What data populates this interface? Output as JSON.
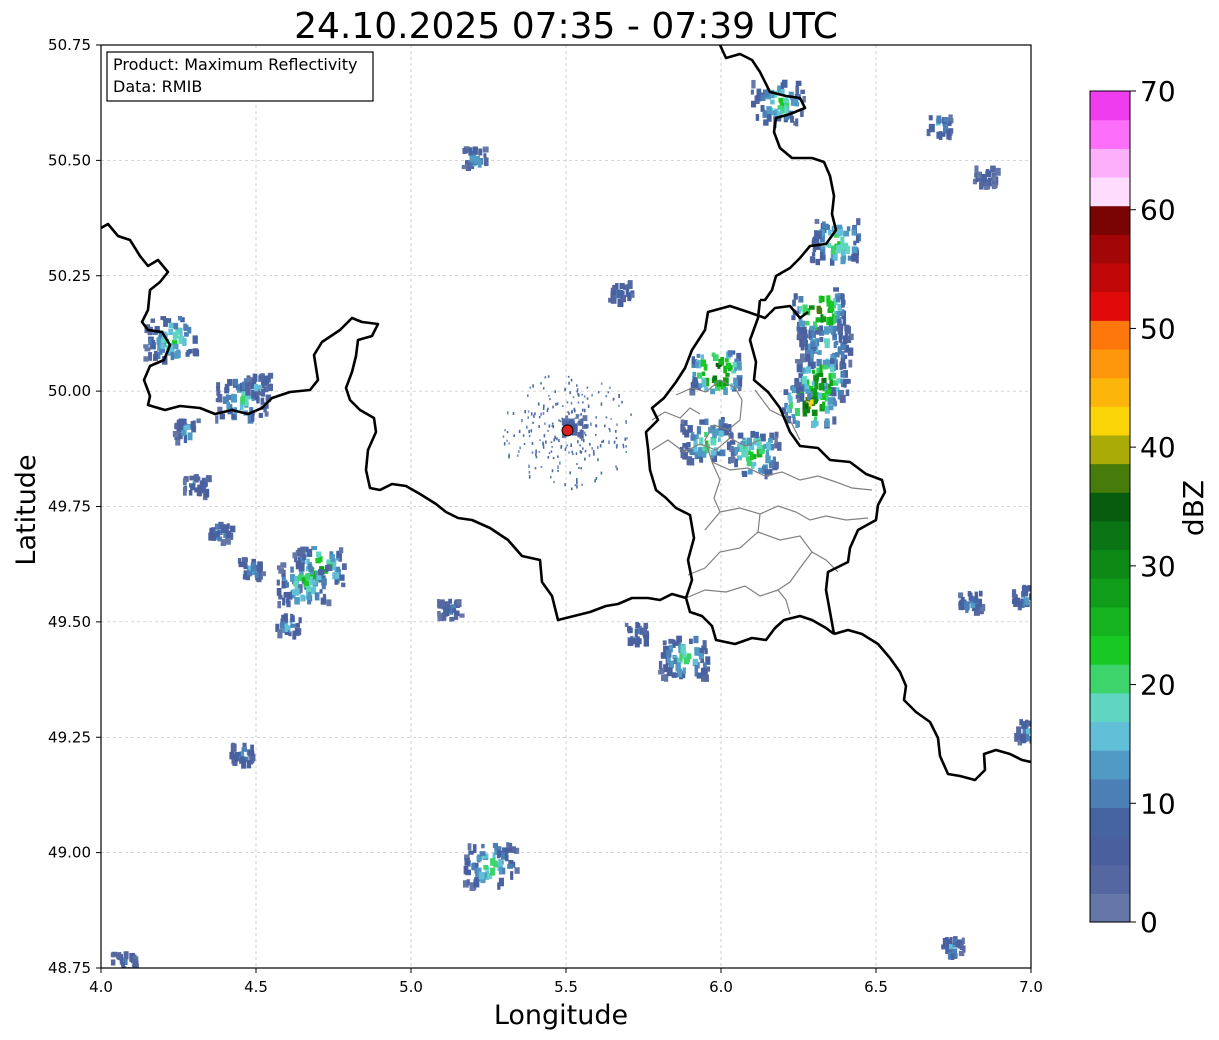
{
  "title": "24.10.2025 07:35 - 07:39 UTC",
  "info_box": {
    "product_line": "Product: Maximum Reflectivity",
    "data_line": "Data: RMIB"
  },
  "map": {
    "xlabel": "Longitude",
    "ylabel": "Latitude",
    "xlim": [
      4.0,
      7.0
    ],
    "ylim": [
      48.75,
      50.75
    ],
    "x_ticks": [
      "4.0",
      "4.5",
      "5.0",
      "5.5",
      "6.0",
      "6.5",
      "7.0"
    ],
    "y_ticks": [
      "48.75",
      "49.00",
      "49.25",
      "49.50",
      "49.75",
      "50.00",
      "50.25",
      "50.50",
      "50.75"
    ],
    "grid": true,
    "radar_site": {
      "lon": 5.505,
      "lat": 49.915,
      "color": "#e02020"
    }
  },
  "colorbar": {
    "label": "dBZ",
    "tick_labels": [
      "0",
      "10",
      "20",
      "30",
      "40",
      "50",
      "60",
      "70"
    ],
    "min": 0,
    "max": 70,
    "colors": [
      "#6477a6",
      "#5467a0",
      "#4a5f9e",
      "#4663a2",
      "#4b7fb6",
      "#509ac4",
      "#62bfd8",
      "#5fd6c2",
      "#3ed46c",
      "#18c924",
      "#15b41e",
      "#109d1a",
      "#0d8a16",
      "#0b7414",
      "#075c0e",
      "#477b0a",
      "#abab08",
      "#fbd408",
      "#fcb50a",
      "#fd960a",
      "#fe770c",
      "#e10a0a",
      "#c10808",
      "#a30606",
      "#7a0404",
      "#fddcfd",
      "#fcb0fb",
      "#fd6ffb",
      "#f03cef"
    ]
  },
  "chart_data": {
    "type": "heatmap",
    "title": "24.10.2025 07:35 - 07:39 UTC",
    "xlabel": "Longitude",
    "ylabel": "Latitude",
    "xlim": [
      4.0,
      7.0
    ],
    "ylim": [
      48.75,
      50.75
    ],
    "value_label": "dBZ",
    "value_range": [
      0,
      70
    ],
    "echo_cells": [
      {
        "lon": 4.22,
        "lat": 50.12,
        "dbz": 22
      },
      {
        "lon": 4.27,
        "lat": 49.92,
        "dbz": 18
      },
      {
        "lon": 4.45,
        "lat": 49.99,
        "dbz": 20
      },
      {
        "lon": 4.5,
        "lat": 50.02,
        "dbz": 16
      },
      {
        "lon": 4.3,
        "lat": 49.8,
        "dbz": 12
      },
      {
        "lon": 4.38,
        "lat": 49.7,
        "dbz": 14
      },
      {
        "lon": 4.48,
        "lat": 49.62,
        "dbz": 16
      },
      {
        "lon": 4.7,
        "lat": 49.62,
        "dbz": 28
      },
      {
        "lon": 4.65,
        "lat": 49.59,
        "dbz": 24
      },
      {
        "lon": 4.6,
        "lat": 49.5,
        "dbz": 18
      },
      {
        "lon": 4.45,
        "lat": 49.22,
        "dbz": 16
      },
      {
        "lon": 5.2,
        "lat": 50.51,
        "dbz": 18
      },
      {
        "lon": 5.67,
        "lat": 50.22,
        "dbz": 10
      },
      {
        "lon": 5.52,
        "lat": 49.93,
        "dbz": 8
      },
      {
        "lon": 6.18,
        "lat": 50.63,
        "dbz": 22
      },
      {
        "lon": 6.37,
        "lat": 50.33,
        "dbz": 24
      },
      {
        "lon": 6.33,
        "lat": 50.1,
        "dbz": 20
      },
      {
        "lon": 6.28,
        "lat": 50.12,
        "dbz": 16
      },
      {
        "lon": 5.98,
        "lat": 50.05,
        "dbz": 38
      },
      {
        "lon": 6.28,
        "lat": 49.98,
        "dbz": 40
      },
      {
        "lon": 6.31,
        "lat": 50.18,
        "dbz": 38
      },
      {
        "lon": 6.1,
        "lat": 49.87,
        "dbz": 26
      },
      {
        "lon": 5.95,
        "lat": 49.9,
        "dbz": 22
      },
      {
        "lon": 6.32,
        "lat": 50.03,
        "dbz": 34
      },
      {
        "lon": 5.72,
        "lat": 49.48,
        "dbz": 12
      },
      {
        "lon": 5.88,
        "lat": 49.43,
        "dbz": 20
      },
      {
        "lon": 5.12,
        "lat": 49.53,
        "dbz": 12
      },
      {
        "lon": 5.25,
        "lat": 48.98,
        "dbz": 22
      },
      {
        "lon": 6.85,
        "lat": 50.47,
        "dbz": 8
      },
      {
        "lon": 6.7,
        "lat": 50.58,
        "dbz": 18
      },
      {
        "lon": 6.8,
        "lat": 49.55,
        "dbz": 16
      },
      {
        "lon": 6.97,
        "lat": 49.56,
        "dbz": 14
      },
      {
        "lon": 6.98,
        "lat": 49.27,
        "dbz": 14
      },
      {
        "lon": 4.07,
        "lat": 48.77,
        "dbz": 10
      },
      {
        "lon": 6.74,
        "lat": 48.8,
        "dbz": 14
      }
    ]
  }
}
